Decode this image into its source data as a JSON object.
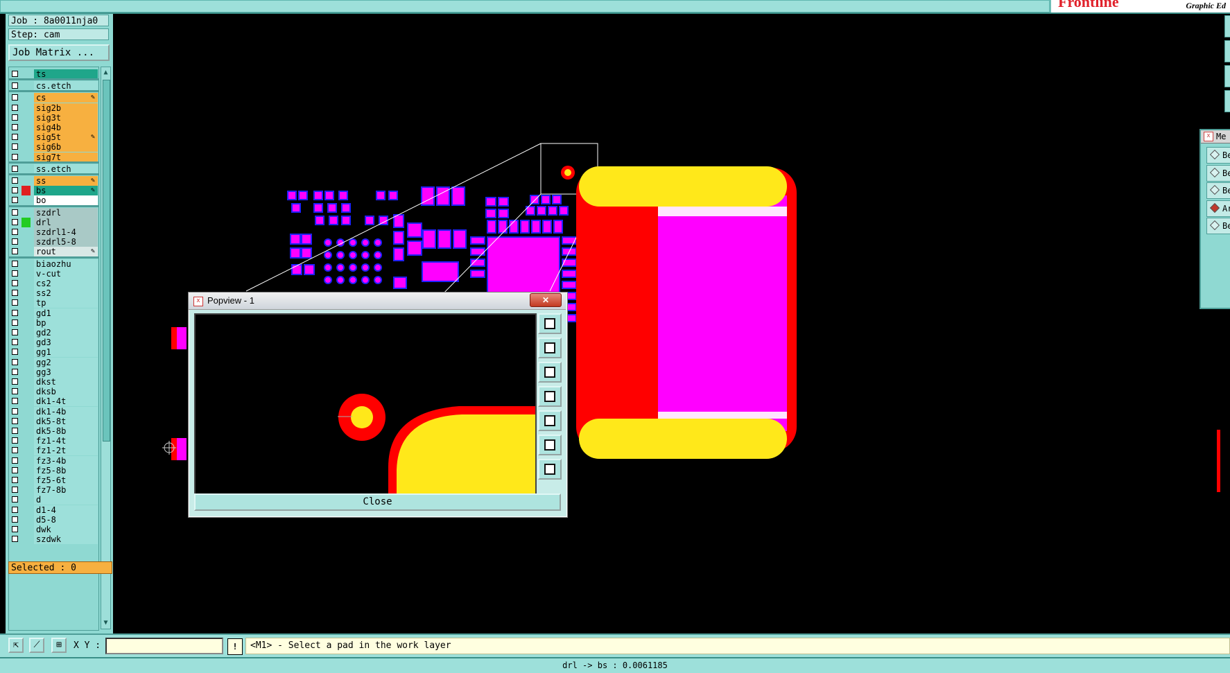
{
  "brand": {
    "logo": "Frontline",
    "subtitle": "Graphic Ed"
  },
  "left_panel": {
    "job_label": "Job : 8a0011nja0",
    "step_label": "Step: cam",
    "job_matrix_button": "Job Matrix ...",
    "layers": [
      {
        "name": "ts",
        "color": "#1fa68a",
        "swatch": "",
        "edit": false,
        "group_start": false
      },
      {
        "name": "cs.etch",
        "color": "#9de0da",
        "swatch": "",
        "edit": false,
        "group_start": true
      },
      {
        "name": "cs",
        "color": "#f7b040",
        "swatch": "",
        "edit": true,
        "group_start": true
      },
      {
        "name": "sig2b",
        "color": "#f7b040",
        "swatch": "",
        "edit": false,
        "group_start": false
      },
      {
        "name": "sig3t",
        "color": "#f7b040",
        "swatch": "",
        "edit": false,
        "group_start": false
      },
      {
        "name": "sig4b",
        "color": "#f7b040",
        "swatch": "",
        "edit": false,
        "group_start": false
      },
      {
        "name": "sig5t",
        "color": "#f7b040",
        "swatch": "",
        "edit": true,
        "group_start": false
      },
      {
        "name": "sig6b",
        "color": "#f7b040",
        "swatch": "",
        "edit": false,
        "group_start": false
      },
      {
        "name": "sig7t",
        "color": "#f7b040",
        "swatch": "",
        "edit": false,
        "group_start": false
      },
      {
        "name": "ss.etch",
        "color": "#9de0da",
        "swatch": "",
        "edit": false,
        "group_start": true
      },
      {
        "name": "ss",
        "color": "#f7b040",
        "swatch": "",
        "edit": true,
        "group_start": true
      },
      {
        "name": "bs",
        "color": "#1fa68a",
        "swatch": "#e02020",
        "edit": true,
        "group_start": false
      },
      {
        "name": "bo",
        "color": "#ffffff",
        "swatch": "",
        "edit": false,
        "group_start": false
      },
      {
        "name": "szdrl",
        "color": "#a9c9c6",
        "swatch": "",
        "edit": false,
        "group_start": true
      },
      {
        "name": "drl",
        "color": "#a9c9c6",
        "swatch": "#22cc22",
        "edit": false,
        "group_start": false
      },
      {
        "name": "szdrl1-4",
        "color": "#a9c9c6",
        "swatch": "",
        "edit": false,
        "group_start": false
      },
      {
        "name": "szdrl5-8",
        "color": "#a9c9c6",
        "swatch": "",
        "edit": false,
        "group_start": false
      },
      {
        "name": "rout",
        "color": "#d9e8e6",
        "swatch": "",
        "edit": true,
        "group_start": false
      },
      {
        "name": "biaozhu",
        "color": "#9de0da",
        "swatch": "",
        "edit": false,
        "group_start": true
      },
      {
        "name": "v-cut",
        "color": "#9de0da",
        "swatch": "",
        "edit": false,
        "group_start": false
      },
      {
        "name": "cs2",
        "color": "#9de0da",
        "swatch": "",
        "edit": false,
        "group_start": false
      },
      {
        "name": "ss2",
        "color": "#9de0da",
        "swatch": "",
        "edit": false,
        "group_start": false
      },
      {
        "name": "tp",
        "color": "#9de0da",
        "swatch": "",
        "edit": false,
        "group_start": false
      },
      {
        "name": "gd1",
        "color": "#9de0da",
        "swatch": "",
        "edit": false,
        "group_start": false
      },
      {
        "name": "bp",
        "color": "#9de0da",
        "swatch": "",
        "edit": false,
        "group_start": false
      },
      {
        "name": "gd2",
        "color": "#9de0da",
        "swatch": "",
        "edit": false,
        "group_start": false
      },
      {
        "name": "gd3",
        "color": "#9de0da",
        "swatch": "",
        "edit": false,
        "group_start": false
      },
      {
        "name": "gg1",
        "color": "#9de0da",
        "swatch": "",
        "edit": false,
        "group_start": false
      },
      {
        "name": "gg2",
        "color": "#9de0da",
        "swatch": "",
        "edit": false,
        "group_start": false
      },
      {
        "name": "gg3",
        "color": "#9de0da",
        "swatch": "",
        "edit": false,
        "group_start": false
      },
      {
        "name": "dkst",
        "color": "#9de0da",
        "swatch": "",
        "edit": false,
        "group_start": false
      },
      {
        "name": "dksb",
        "color": "#9de0da",
        "swatch": "",
        "edit": false,
        "group_start": false
      },
      {
        "name": "dk1-4t",
        "color": "#9de0da",
        "swatch": "",
        "edit": false,
        "group_start": false
      },
      {
        "name": "dk1-4b",
        "color": "#9de0da",
        "swatch": "",
        "edit": false,
        "group_start": false
      },
      {
        "name": "dk5-8t",
        "color": "#9de0da",
        "swatch": "",
        "edit": false,
        "group_start": false
      },
      {
        "name": "dk5-8b",
        "color": "#9de0da",
        "swatch": "",
        "edit": false,
        "group_start": false
      },
      {
        "name": "fz1-4t",
        "color": "#9de0da",
        "swatch": "",
        "edit": false,
        "group_start": false
      },
      {
        "name": "fz1-2t",
        "color": "#9de0da",
        "swatch": "",
        "edit": false,
        "group_start": false
      },
      {
        "name": "fz3-4b",
        "color": "#9de0da",
        "swatch": "",
        "edit": false,
        "group_start": false
      },
      {
        "name": "fz5-8b",
        "color": "#9de0da",
        "swatch": "",
        "edit": false,
        "group_start": false
      },
      {
        "name": "fz5-6t",
        "color": "#9de0da",
        "swatch": "",
        "edit": false,
        "group_start": false
      },
      {
        "name": "fz7-8b",
        "color": "#9de0da",
        "swatch": "",
        "edit": false,
        "group_start": false
      },
      {
        "name": "d",
        "color": "#9de0da",
        "swatch": "",
        "edit": false,
        "group_start": false
      },
      {
        "name": "d1-4",
        "color": "#9de0da",
        "swatch": "",
        "edit": false,
        "group_start": false
      },
      {
        "name": "d5-8",
        "color": "#9de0da",
        "swatch": "",
        "edit": false,
        "group_start": false
      },
      {
        "name": "dwk",
        "color": "#9de0da",
        "swatch": "",
        "edit": false,
        "group_start": false
      },
      {
        "name": "szdwk",
        "color": "#9de0da",
        "swatch": "",
        "edit": false,
        "group_start": false
      }
    ],
    "selected_label": "Selected : 0"
  },
  "command_bar": {
    "xy_label": "X Y :",
    "xy_value": "",
    "message": "<M1> - Select a pad in the work layer"
  },
  "status_bar": {
    "text": "drl -> bs : 0.0061185"
  },
  "popview": {
    "title": "Popview - 1",
    "close_button": "Close",
    "tool_icons": [
      "zoom-window-icon",
      "pan-up-icon",
      "pan-down-icon",
      "pan-left-icon",
      "pan-right-icon",
      "zoom-fit-icon",
      "zoom-home-icon"
    ]
  },
  "right_panel": {
    "title": "Me",
    "items": [
      {
        "label": "Be",
        "selected": false
      },
      {
        "label": "Be",
        "selected": false
      },
      {
        "label": "Be",
        "selected": false
      },
      {
        "label": "Ar",
        "selected": true
      },
      {
        "label": "Be",
        "selected": false
      }
    ]
  },
  "colors": {
    "pad_magenta": "#ff00ff",
    "pad_yellow": "#ffe81a",
    "pad_red": "#ff0000",
    "outline_blue": "#2020ff"
  }
}
